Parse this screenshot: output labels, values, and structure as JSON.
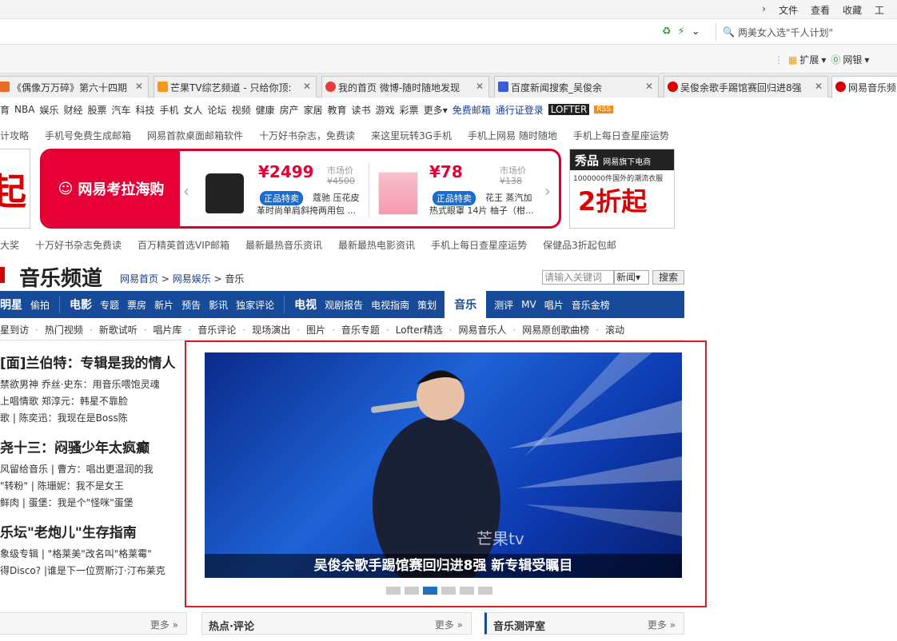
{
  "menubar": {
    "items": [
      "文件",
      "查看",
      "收藏",
      "工"
    ]
  },
  "address": {
    "search_placeholder": "两美女入选\"千人计划\""
  },
  "extensions": {
    "expand": "扩展",
    "netbank": "网银"
  },
  "tabs": [
    {
      "label": "《偶像万万碎》第六十四期",
      "color": "#e86b2a"
    },
    {
      "label": "芒果TV综艺频道 - 只给你顶:",
      "color": "#f29a1b"
    },
    {
      "label": "我的首页 微博-随时随地发现",
      "color": "#e83b3b"
    },
    {
      "label": "百度新闻搜索_吴俊余",
      "color": "#3b5bdb"
    },
    {
      "label": "吴俊余歌手踢馆赛回归进8强",
      "color": "#d80000"
    },
    {
      "label": "网易音乐频",
      "color": "#d80000"
    }
  ],
  "nav1": [
    "育",
    "NBA",
    "娱乐",
    "财经",
    "股票",
    "汽车",
    "科技",
    "手机",
    "女人",
    "论坛",
    "视频",
    "健康",
    "房产",
    "家居",
    "教育",
    "读书",
    "游戏",
    "彩票",
    "更多▾",
    "免费邮箱",
    "通行证登录",
    "LOFTER",
    "RSS"
  ],
  "promo1": [
    "计攻略",
    "手机号免费生成邮箱",
    "网易首款桌面邮箱软件",
    "十万好书杂志，免费读",
    "来这里玩转3G手机",
    "手机上网易 随时随地",
    "手机上每日查星座运势"
  ],
  "kaola": {
    "brand": "网易考拉海购",
    "p1": {
      "price": "¥2499",
      "mkt_label": "市场价",
      "mkt": "¥4500",
      "tag": "正品特卖",
      "brand": "蔻驰 压花皮",
      "desc": "革时尚单肩斜挎两用包 ..."
    },
    "p2": {
      "price": "¥78",
      "mkt_label": "市场价",
      "mkt": "¥138",
      "tag": "正品特卖",
      "brand": "花王 蒸汽加",
      "desc": "热式眼罩 14片 柚子（柑..."
    }
  },
  "left_ad": {
    "text": "起"
  },
  "xiupin": {
    "brand": "秀品",
    "sub": "网易旗下电商",
    "line": "1000000件国外的潮流衣服",
    "big": "2折起"
  },
  "promo2": [
    "大奖",
    "十万好书杂志免费读",
    "百万精英首选VIP邮箱",
    "最新最热音乐资讯",
    "最新最热电影资讯",
    "手机上每日查星座运势",
    "保健品3折起包邮"
  ],
  "channel": {
    "title": "音乐频道",
    "crumb1": "网易首页",
    "crumb2": "网易娱乐",
    "crumb3": "音乐",
    "search_placeholder": "请输入关键词",
    "select": "新闻▾",
    "search_btn": "搜索"
  },
  "mainnav": {
    "g1": [
      "明星",
      "偷拍"
    ],
    "g2big": "电影",
    "g2": [
      "专题",
      "票房",
      "新片",
      "预告",
      "影讯",
      "独家评论"
    ],
    "g3big": "电视",
    "g3": [
      "观剧报告",
      "电视指南",
      "策划"
    ],
    "active": "音乐",
    "g4": [
      "测评",
      "MV",
      "唱片",
      "音乐金榜"
    ]
  },
  "subnav": [
    "星到访",
    "热门视频",
    "新歌试听",
    "唱片库",
    "音乐评论",
    "现场演出",
    "图片",
    "音乐专题",
    "Lofter精选",
    "网易音乐人",
    "网易原创歌曲榜",
    "滚动"
  ],
  "news": [
    {
      "headline": "[面]兰伯特：专辑是我的情人",
      "subs": [
        "禁欲男神 乔丝·史东：用音乐喂饱灵魂",
        "上唱情歌 郑淳元：韩星不靠脸",
        "歌 | 陈奕迅：我现在是Boss陈"
      ]
    },
    {
      "headline": "尧十三：闷骚少年太疯癫",
      "subs": [
        "风留给音乐 | 曹方：唱出更温润的我",
        "\"转粉\" | 陈珊妮：我不是女王",
        "鲜肉 | 蛋堡：我是个\"怪咪\"蛋堡"
      ]
    },
    {
      "headline": "乐坛\"老炮儿\"生存指南",
      "subs": [
        "象级专辑 | \"格莱美\"改名叫\"格莱霉\"",
        "得Disco? |谁是下一位贾斯汀·汀布莱克"
      ]
    }
  ],
  "focus": {
    "caption": "吴俊余歌手踢馆赛回归进8强 新专辑受瞩目",
    "dots": 6,
    "active_dot": 2,
    "watermark": "芒果tv"
  },
  "bottom": {
    "more1": "更多",
    "hot_title": "热点·评论",
    "more2": "更多",
    "review_title": "音乐测评室",
    "more3": "更多"
  }
}
